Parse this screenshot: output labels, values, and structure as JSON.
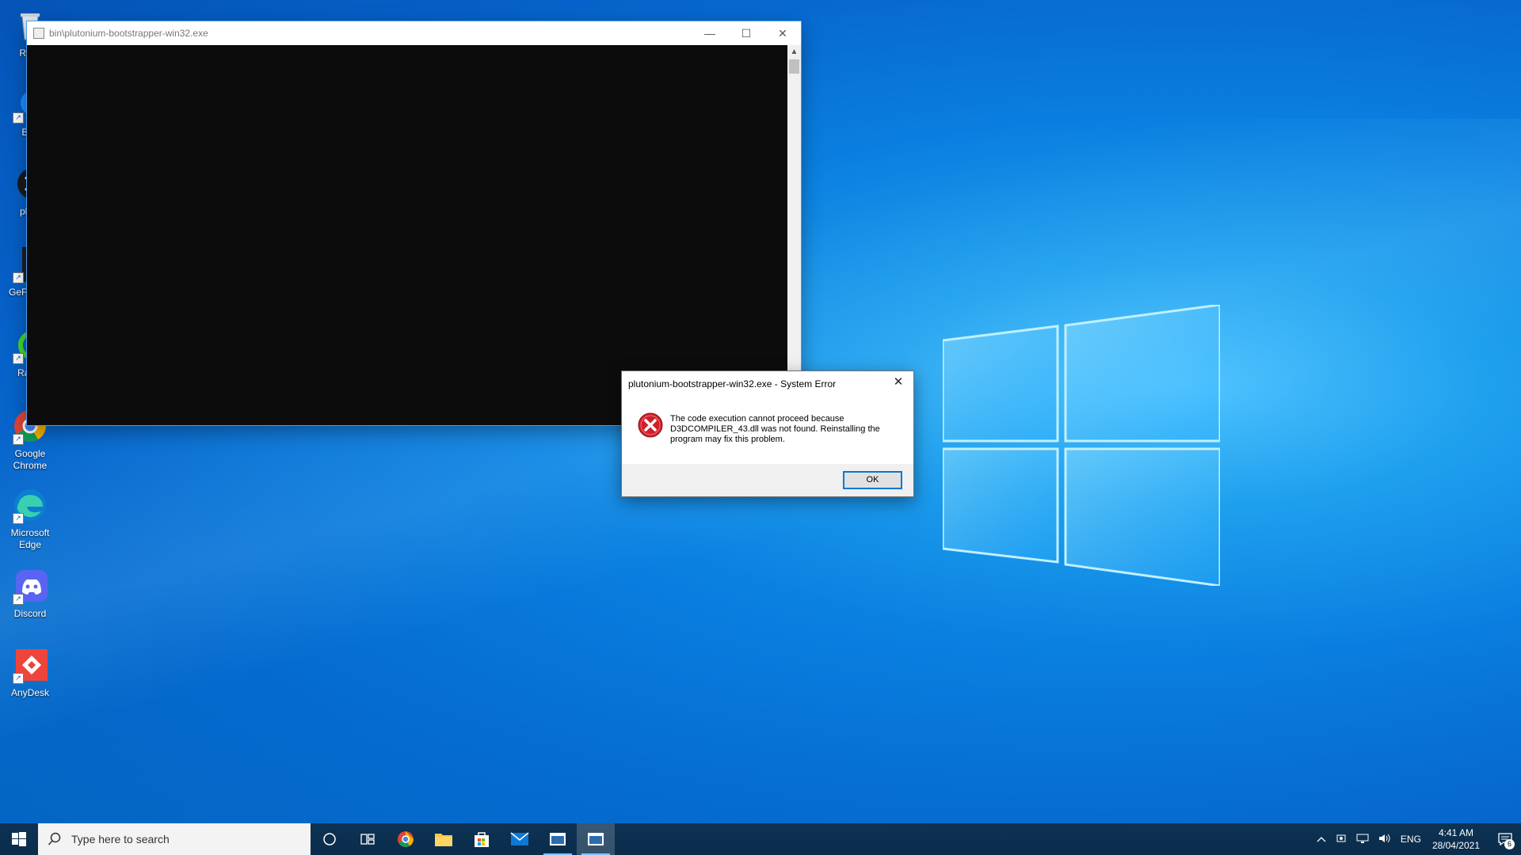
{
  "desktop": {
    "icons": [
      {
        "label": "Recy",
        "icon": "recycle-bin-icon"
      },
      {
        "label": "Batt",
        "icon": "battlenet-icon"
      },
      {
        "label": "pluto",
        "icon": "plutonium-icon"
      },
      {
        "label": "GeF Expe",
        "icon": "geforce-experience-icon"
      },
      {
        "label": "Razer",
        "icon": "razer-icon"
      },
      {
        "label": "Google Chrome",
        "icon": "chrome-icon"
      },
      {
        "label": "Microsoft Edge",
        "icon": "edge-icon"
      },
      {
        "label": "Discord",
        "icon": "discord-icon"
      },
      {
        "label": "AnyDesk",
        "icon": "anydesk-icon"
      }
    ]
  },
  "console_window": {
    "title": "bin\\plutonium-bootstrapper-win32.exe",
    "minimize": "—",
    "maximize": "☐",
    "close": "✕",
    "scroll_up": "▲"
  },
  "error_dialog": {
    "title": "plutonium-bootstrapper-win32.exe - System Error",
    "close": "✕",
    "message": "The code execution cannot proceed because D3DCOMPILER_43.dll was not found. Reinstalling the program may fix this problem.",
    "ok_label": "OK"
  },
  "taskbar": {
    "search_placeholder": "Type here to search",
    "apps": [
      "cortana-icon",
      "task-view-icon",
      "chrome-icon",
      "file-explorer-icon",
      "store-icon",
      "mail-icon",
      "console-app-icon",
      "console-app-icon-active"
    ],
    "tray": {
      "language": "ENG",
      "time": "4:41 AM",
      "date": "28/04/2021",
      "notification_count": "6"
    }
  },
  "colors": {
    "accent": "#0078d7",
    "taskbar": "#0b2c4b",
    "desktop_blue": "#0a7fe0",
    "error_red": "#d0202a"
  }
}
